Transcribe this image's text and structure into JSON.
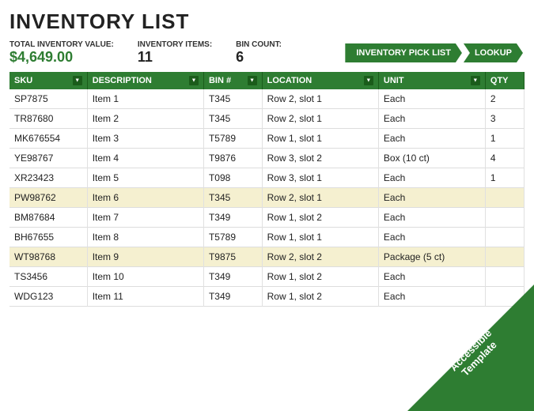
{
  "page": {
    "title": "INVENTORY LIST"
  },
  "summary": {
    "total_value_label": "TOTAL INVENTORY VALUE:",
    "total_value": "$4,649.00",
    "items_label": "INVENTORY ITEMS:",
    "items_count": "11",
    "bin_label": "BIN COUNT:",
    "bin_count": "6"
  },
  "buttons": {
    "pick_list": "INVENTORY PICK LIST",
    "lookup": "LOOKUP"
  },
  "table": {
    "headers": [
      "SKU",
      "DESCRIPTION",
      "BIN #",
      "LOCATION",
      "UNIT",
      "QTY"
    ],
    "rows": [
      {
        "sku": "SP7875",
        "desc": "Item 1",
        "bin": "T345",
        "location": "Row 2, slot 1",
        "unit": "Each",
        "qty": "2",
        "highlight": false
      },
      {
        "sku": "TR87680",
        "desc": "Item 2",
        "bin": "T345",
        "location": "Row 2, slot 1",
        "unit": "Each",
        "qty": "3",
        "highlight": false
      },
      {
        "sku": "MK676554",
        "desc": "Item 3",
        "bin": "T5789",
        "location": "Row 1, slot 1",
        "unit": "Each",
        "qty": "1",
        "highlight": false
      },
      {
        "sku": "YE98767",
        "desc": "Item 4",
        "bin": "T9876",
        "location": "Row 3, slot 2",
        "unit": "Box (10 ct)",
        "qty": "4",
        "highlight": false
      },
      {
        "sku": "XR23423",
        "desc": "Item 5",
        "bin": "T098",
        "location": "Row 3, slot 1",
        "unit": "Each",
        "qty": "1",
        "highlight": false
      },
      {
        "sku": "PW98762",
        "desc": "Item 6",
        "bin": "T345",
        "location": "Row 2, slot 1",
        "unit": "Each",
        "qty": "",
        "highlight": true
      },
      {
        "sku": "BM87684",
        "desc": "Item 7",
        "bin": "T349",
        "location": "Row 1, slot 2",
        "unit": "Each",
        "qty": "",
        "highlight": false
      },
      {
        "sku": "BH67655",
        "desc": "Item 8",
        "bin": "T5789",
        "location": "Row 1, slot 1",
        "unit": "Each",
        "qty": "",
        "highlight": false
      },
      {
        "sku": "WT98768",
        "desc": "Item 9",
        "bin": "T9875",
        "location": "Row 2, slot 2",
        "unit": "Package (5 ct)",
        "qty": "",
        "highlight": true
      },
      {
        "sku": "TS3456",
        "desc": "Item 10",
        "bin": "T349",
        "location": "Row 1, slot 2",
        "unit": "Each",
        "qty": "",
        "highlight": false
      },
      {
        "sku": "WDG123",
        "desc": "Item 11",
        "bin": "T349",
        "location": "Row 1, slot 2",
        "unit": "Each",
        "qty": "",
        "highlight": false
      }
    ]
  },
  "watermark": {
    "line1": "Accessible",
    "line2": "Template"
  }
}
